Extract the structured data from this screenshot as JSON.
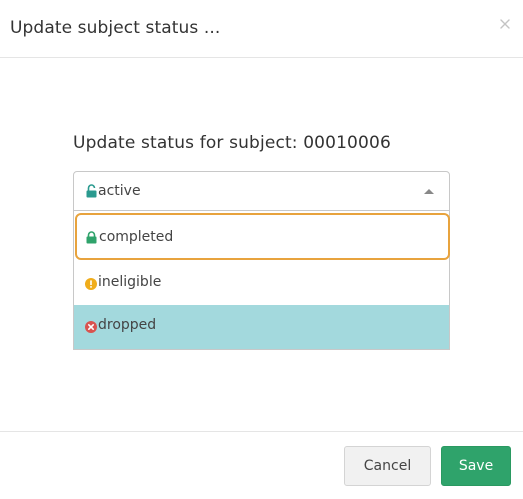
{
  "modal": {
    "title": "Update subject status ...",
    "close_icon": "close-icon"
  },
  "prompt": {
    "text": "Update status for subject: 00010006"
  },
  "status_select": {
    "selected": {
      "label": "active",
      "icon": "unlock-icon",
      "color": "#2a9a8f"
    },
    "options": [
      {
        "label": "completed",
        "icon": "lock-icon",
        "color": "#2fa36b",
        "state": "focused"
      },
      {
        "label": "ineligible",
        "icon": "warning-icon",
        "color": "#f0ad1b",
        "state": "normal"
      },
      {
        "label": "dropped",
        "icon": "error-icon",
        "color": "#d9534f",
        "state": "hover"
      }
    ]
  },
  "footer": {
    "cancel_label": "Cancel",
    "save_label": "Save"
  },
  "colors": {
    "focus_outline": "#e8a33d",
    "hover_bg": "#a3d9dd",
    "save_bg": "#2fa36b"
  }
}
